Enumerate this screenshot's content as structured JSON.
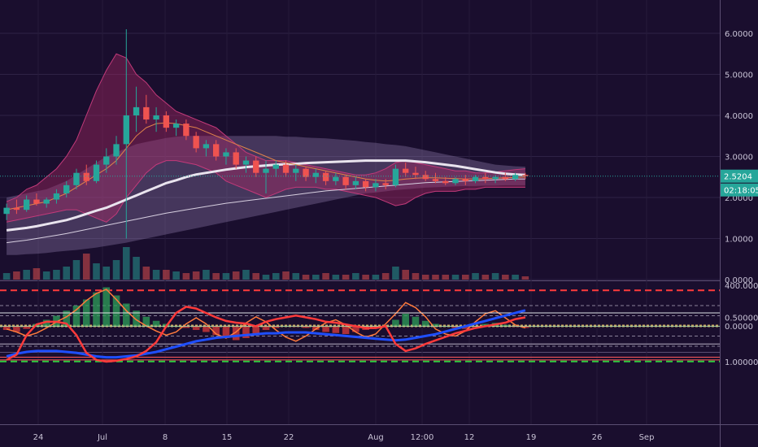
{
  "chart_data": {
    "type": "candlestick",
    "x_ticks": [
      "24",
      "Jul",
      "8",
      "15",
      "22",
      "Aug",
      "12:00",
      "12",
      "19",
      "26",
      "Sep"
    ],
    "price_panel": {
      "y_ticks": [
        "6.0000",
        "5.0000",
        "4.0000",
        "3.0000",
        "2.0000",
        "1.0000",
        "0.0000"
      ],
      "ylim": [
        0,
        6.5
      ],
      "last_price": "2.5204",
      "countdown": "02:18:05",
      "candles": [
        {
          "o": 1.6,
          "h": 1.85,
          "l": 1.45,
          "c": 1.75
        },
        {
          "o": 1.75,
          "h": 1.95,
          "l": 1.6,
          "c": 1.7
        },
        {
          "o": 1.7,
          "h": 2.05,
          "l": 1.65,
          "c": 1.95
        },
        {
          "o": 1.95,
          "h": 2.1,
          "l": 1.8,
          "c": 1.85
        },
        {
          "o": 1.85,
          "h": 2.0,
          "l": 1.75,
          "c": 1.95
        },
        {
          "o": 1.95,
          "h": 2.2,
          "l": 1.85,
          "c": 2.1
        },
        {
          "o": 2.1,
          "h": 2.4,
          "l": 2.0,
          "c": 2.3
        },
        {
          "o": 2.3,
          "h": 2.7,
          "l": 2.2,
          "c": 2.6
        },
        {
          "o": 2.6,
          "h": 2.8,
          "l": 2.3,
          "c": 2.4
        },
        {
          "o": 2.4,
          "h": 2.9,
          "l": 2.35,
          "c": 2.8
        },
        {
          "o": 2.8,
          "h": 3.2,
          "l": 2.6,
          "c": 3.0
        },
        {
          "o": 3.0,
          "h": 3.5,
          "l": 2.8,
          "c": 3.3
        },
        {
          "o": 3.3,
          "h": 6.1,
          "l": 1.0,
          "c": 4.0
        },
        {
          "o": 4.0,
          "h": 4.7,
          "l": 3.6,
          "c": 4.2
        },
        {
          "o": 4.2,
          "h": 4.5,
          "l": 3.8,
          "c": 3.9
        },
        {
          "o": 3.9,
          "h": 4.2,
          "l": 3.6,
          "c": 4.0
        },
        {
          "o": 4.0,
          "h": 4.1,
          "l": 3.6,
          "c": 3.7
        },
        {
          "o": 3.7,
          "h": 3.9,
          "l": 3.5,
          "c": 3.8
        },
        {
          "o": 3.8,
          "h": 3.9,
          "l": 3.4,
          "c": 3.5
        },
        {
          "o": 3.5,
          "h": 3.6,
          "l": 3.1,
          "c": 3.2
        },
        {
          "o": 3.2,
          "h": 3.4,
          "l": 3.0,
          "c": 3.3
        },
        {
          "o": 3.3,
          "h": 3.4,
          "l": 2.9,
          "c": 3.0
        },
        {
          "o": 3.0,
          "h": 3.2,
          "l": 2.8,
          "c": 3.1
        },
        {
          "o": 3.1,
          "h": 3.2,
          "l": 2.7,
          "c": 2.8
        },
        {
          "o": 2.8,
          "h": 3.0,
          "l": 2.6,
          "c": 2.9
        },
        {
          "o": 2.9,
          "h": 3.0,
          "l": 2.5,
          "c": 2.6
        },
        {
          "o": 2.6,
          "h": 2.9,
          "l": 2.1,
          "c": 2.7
        },
        {
          "o": 2.7,
          "h": 2.9,
          "l": 2.5,
          "c": 2.8
        },
        {
          "o": 2.8,
          "h": 2.9,
          "l": 2.5,
          "c": 2.6
        },
        {
          "o": 2.6,
          "h": 2.8,
          "l": 2.4,
          "c": 2.7
        },
        {
          "o": 2.7,
          "h": 2.75,
          "l": 2.4,
          "c": 2.5
        },
        {
          "o": 2.5,
          "h": 2.7,
          "l": 2.35,
          "c": 2.6
        },
        {
          "o": 2.6,
          "h": 2.65,
          "l": 2.3,
          "c": 2.4
        },
        {
          "o": 2.4,
          "h": 2.6,
          "l": 2.3,
          "c": 2.5
        },
        {
          "o": 2.5,
          "h": 2.55,
          "l": 2.2,
          "c": 2.3
        },
        {
          "o": 2.3,
          "h": 2.5,
          "l": 2.2,
          "c": 2.4
        },
        {
          "o": 2.4,
          "h": 2.45,
          "l": 2.15,
          "c": 2.25
        },
        {
          "o": 2.25,
          "h": 2.45,
          "l": 2.15,
          "c": 2.35
        },
        {
          "o": 2.35,
          "h": 2.45,
          "l": 2.2,
          "c": 2.3
        },
        {
          "o": 2.3,
          "h": 2.8,
          "l": 2.25,
          "c": 2.7
        },
        {
          "o": 2.7,
          "h": 2.85,
          "l": 2.5,
          "c": 2.6
        },
        {
          "o": 2.6,
          "h": 2.75,
          "l": 2.45,
          "c": 2.55
        },
        {
          "o": 2.55,
          "h": 2.65,
          "l": 2.4,
          "c": 2.45
        },
        {
          "o": 2.45,
          "h": 2.6,
          "l": 2.35,
          "c": 2.4
        },
        {
          "o": 2.4,
          "h": 2.5,
          "l": 2.3,
          "c": 2.35
        },
        {
          "o": 2.35,
          "h": 2.5,
          "l": 2.3,
          "c": 2.45
        },
        {
          "o": 2.45,
          "h": 2.55,
          "l": 2.3,
          "c": 2.4
        },
        {
          "o": 2.4,
          "h": 2.55,
          "l": 2.35,
          "c": 2.5
        },
        {
          "o": 2.5,
          "h": 2.6,
          "l": 2.35,
          "c": 2.45
        },
        {
          "o": 2.45,
          "h": 2.55,
          "l": 2.35,
          "c": 2.5
        },
        {
          "o": 2.5,
          "h": 2.6,
          "l": 2.4,
          "c": 2.45
        },
        {
          "o": 2.45,
          "h": 2.6,
          "l": 2.4,
          "c": 2.55
        },
        {
          "o": 2.55,
          "h": 2.6,
          "l": 2.45,
          "c": 2.52
        }
      ],
      "bb_upper": [
        1.9,
        2.0,
        2.2,
        2.3,
        2.5,
        2.7,
        3.0,
        3.4,
        4.0,
        4.6,
        5.1,
        5.5,
        5.4,
        5.0,
        4.8,
        4.5,
        4.3,
        4.1,
        4.0,
        3.9,
        3.8,
        3.7,
        3.5,
        3.3,
        3.1,
        3.0,
        2.9,
        2.9,
        2.9,
        2.85,
        2.8,
        2.75,
        2.7,
        2.65,
        2.6,
        2.55,
        2.55,
        2.6,
        2.7,
        2.85,
        2.9,
        2.85,
        2.8,
        2.75,
        2.7,
        2.65,
        2.65,
        2.6,
        2.6,
        2.62,
        2.65,
        2.68,
        2.7
      ],
      "bb_lower": [
        1.4,
        1.45,
        1.5,
        1.55,
        1.6,
        1.65,
        1.7,
        1.7,
        1.6,
        1.5,
        1.4,
        1.6,
        2.0,
        2.3,
        2.6,
        2.8,
        2.9,
        2.9,
        2.85,
        2.8,
        2.7,
        2.6,
        2.4,
        2.3,
        2.2,
        2.1,
        2.0,
        2.1,
        2.2,
        2.25,
        2.25,
        2.25,
        2.2,
        2.2,
        2.15,
        2.1,
        2.05,
        2.0,
        1.9,
        1.8,
        1.85,
        2.0,
        2.1,
        2.15,
        2.15,
        2.15,
        2.2,
        2.2,
        2.25,
        2.25,
        2.25,
        2.25,
        2.25
      ],
      "env_upper": [
        2.0,
        2.05,
        2.1,
        2.15,
        2.2,
        2.3,
        2.4,
        2.55,
        2.7,
        2.85,
        3.0,
        3.1,
        3.2,
        3.3,
        3.35,
        3.4,
        3.45,
        3.48,
        3.5,
        3.5,
        3.5,
        3.5,
        3.5,
        3.5,
        3.5,
        3.5,
        3.5,
        3.5,
        3.48,
        3.48,
        3.46,
        3.45,
        3.44,
        3.42,
        3.4,
        3.38,
        3.35,
        3.33,
        3.3,
        3.28,
        3.25,
        3.2,
        3.15,
        3.1,
        3.05,
        3.0,
        2.95,
        2.9,
        2.85,
        2.8,
        2.78,
        2.76,
        2.75
      ],
      "env_lower": [
        0.6,
        0.6,
        0.62,
        0.63,
        0.65,
        0.68,
        0.7,
        0.72,
        0.75,
        0.78,
        0.82,
        0.86,
        0.9,
        0.95,
        1.0,
        1.05,
        1.1,
        1.15,
        1.2,
        1.25,
        1.3,
        1.35,
        1.4,
        1.45,
        1.5,
        1.55,
        1.6,
        1.65,
        1.7,
        1.75,
        1.8,
        1.85,
        1.9,
        1.95,
        2.0,
        2.05,
        2.1,
        2.12,
        2.15,
        2.18,
        2.2,
        2.22,
        2.24,
        2.25,
        2.26,
        2.27,
        2.28,
        2.28,
        2.29,
        2.29,
        2.3,
        2.3,
        2.3
      ],
      "ma_slow": [
        1.2,
        1.23,
        1.26,
        1.3,
        1.35,
        1.4,
        1.45,
        1.52,
        1.6,
        1.68,
        1.75,
        1.85,
        1.95,
        2.05,
        2.15,
        2.25,
        2.35,
        2.42,
        2.5,
        2.56,
        2.6,
        2.64,
        2.68,
        2.71,
        2.74,
        2.76,
        2.78,
        2.8,
        2.81,
        2.82,
        2.84,
        2.85,
        2.86,
        2.87,
        2.88,
        2.89,
        2.9,
        2.9,
        2.9,
        2.9,
        2.9,
        2.88,
        2.86,
        2.83,
        2.8,
        2.77,
        2.73,
        2.69,
        2.65,
        2.61,
        2.58,
        2.56,
        2.55
      ],
      "ma_mid": [
        0.9,
        0.93,
        0.96,
        1.0,
        1.04,
        1.08,
        1.12,
        1.17,
        1.22,
        1.27,
        1.32,
        1.37,
        1.42,
        1.47,
        1.52,
        1.57,
        1.62,
        1.66,
        1.7,
        1.74,
        1.78,
        1.82,
        1.86,
        1.89,
        1.92,
        1.95,
        1.98,
        2.01,
        2.04,
        2.07,
        2.1,
        2.13,
        2.16,
        2.18,
        2.2,
        2.22,
        2.24,
        2.26,
        2.28,
        2.3,
        2.32,
        2.34,
        2.36,
        2.37,
        2.38,
        2.39,
        2.4,
        2.41,
        2.42,
        2.43,
        2.44,
        2.45,
        2.45
      ],
      "ma_fast": [
        1.7,
        1.75,
        1.8,
        1.85,
        1.9,
        2.0,
        2.1,
        2.25,
        2.4,
        2.55,
        2.7,
        2.9,
        3.2,
        3.5,
        3.7,
        3.8,
        3.82,
        3.8,
        3.75,
        3.7,
        3.6,
        3.5,
        3.4,
        3.3,
        3.2,
        3.1,
        3.0,
        2.9,
        2.85,
        2.8,
        2.75,
        2.7,
        2.65,
        2.6,
        2.55,
        2.5,
        2.45,
        2.42,
        2.4,
        2.42,
        2.45,
        2.47,
        2.48,
        2.48,
        2.47,
        2.46,
        2.45,
        2.45,
        2.46,
        2.47,
        2.48,
        2.49,
        2.5
      ],
      "volume": [
        0.2,
        0.25,
        0.3,
        0.35,
        0.25,
        0.3,
        0.4,
        0.6,
        0.8,
        0.5,
        0.4,
        0.6,
        1.0,
        0.7,
        0.4,
        0.3,
        0.3,
        0.25,
        0.2,
        0.25,
        0.3,
        0.2,
        0.2,
        0.25,
        0.3,
        0.2,
        0.15,
        0.2,
        0.25,
        0.2,
        0.15,
        0.15,
        0.2,
        0.15,
        0.15,
        0.2,
        0.15,
        0.15,
        0.2,
        0.4,
        0.3,
        0.2,
        0.15,
        0.15,
        0.15,
        0.15,
        0.15,
        0.2,
        0.15,
        0.2,
        0.15,
        0.15,
        0.1
      ]
    },
    "osc_panel": {
      "y_ticks": [
        "400.0000",
        "0.0000"
      ],
      "ylim": [
        -500,
        400
      ],
      "levels": [
        {
          "value": 350,
          "color": "#ff3b3b"
        },
        {
          "value": -350,
          "color": "#2ecc40"
        }
      ],
      "histogram": [
        -40,
        -60,
        -30,
        20,
        60,
        100,
        150,
        200,
        260,
        330,
        380,
        300,
        220,
        150,
        90,
        50,
        20,
        0,
        -20,
        -40,
        -60,
        -90,
        -120,
        -140,
        -120,
        -80,
        -40,
        -20,
        0,
        -10,
        -20,
        -40,
        -60,
        -70,
        -80,
        -60,
        -40,
        -20,
        0,
        60,
        120,
        90,
        50,
        20,
        0,
        -20,
        -30,
        -10,
        20,
        30,
        10,
        -10,
        -20
      ],
      "line": [
        -30,
        -60,
        -100,
        -70,
        -20,
        40,
        90,
        160,
        250,
        320,
        360,
        260,
        150,
        60,
        0,
        -50,
        -90,
        -60,
        20,
        80,
        20,
        -80,
        -120,
        -60,
        30,
        90,
        40,
        -40,
        -110,
        -150,
        -100,
        -30,
        30,
        60,
        10,
        -60,
        -110,
        -80,
        20,
        120,
        230,
        180,
        90,
        -30,
        -80,
        -100,
        -50,
        40,
        120,
        150,
        80,
        10,
        -20
      ]
    },
    "stoch_panel": {
      "y_ticks": [
        "1.00000",
        "0.50000"
      ],
      "ylim": [
        0.3,
        1.05
      ],
      "levels": [
        0.95,
        0.8,
        0.6,
        0.45
      ],
      "red_line": [
        0.98,
        0.92,
        0.7,
        0.58,
        0.55,
        0.55,
        0.57,
        0.7,
        0.9,
        0.98,
        1.0,
        0.99,
        0.97,
        0.94,
        0.88,
        0.78,
        0.6,
        0.45,
        0.38,
        0.4,
        0.45,
        0.5,
        0.54,
        0.56,
        0.57,
        0.6,
        0.55,
        0.52,
        0.5,
        0.48,
        0.5,
        0.52,
        0.55,
        0.56,
        0.58,
        0.6,
        0.62,
        0.62,
        0.6,
        0.8,
        0.88,
        0.85,
        0.8,
        0.76,
        0.72,
        0.68,
        0.65,
        0.62,
        0.6,
        0.58,
        0.56,
        0.52,
        0.5
      ],
      "blue_line": [
        0.94,
        0.91,
        0.89,
        0.88,
        0.88,
        0.88,
        0.89,
        0.9,
        0.92,
        0.94,
        0.95,
        0.95,
        0.94,
        0.93,
        0.91,
        0.89,
        0.86,
        0.83,
        0.8,
        0.77,
        0.75,
        0.73,
        0.72,
        0.71,
        0.7,
        0.69,
        0.68,
        0.68,
        0.67,
        0.67,
        0.67,
        0.68,
        0.69,
        0.7,
        0.71,
        0.72,
        0.73,
        0.74,
        0.75,
        0.76,
        0.75,
        0.73,
        0.71,
        0.69,
        0.66,
        0.63,
        0.6,
        0.57,
        0.54,
        0.51,
        0.48,
        0.45,
        0.42
      ]
    }
  }
}
